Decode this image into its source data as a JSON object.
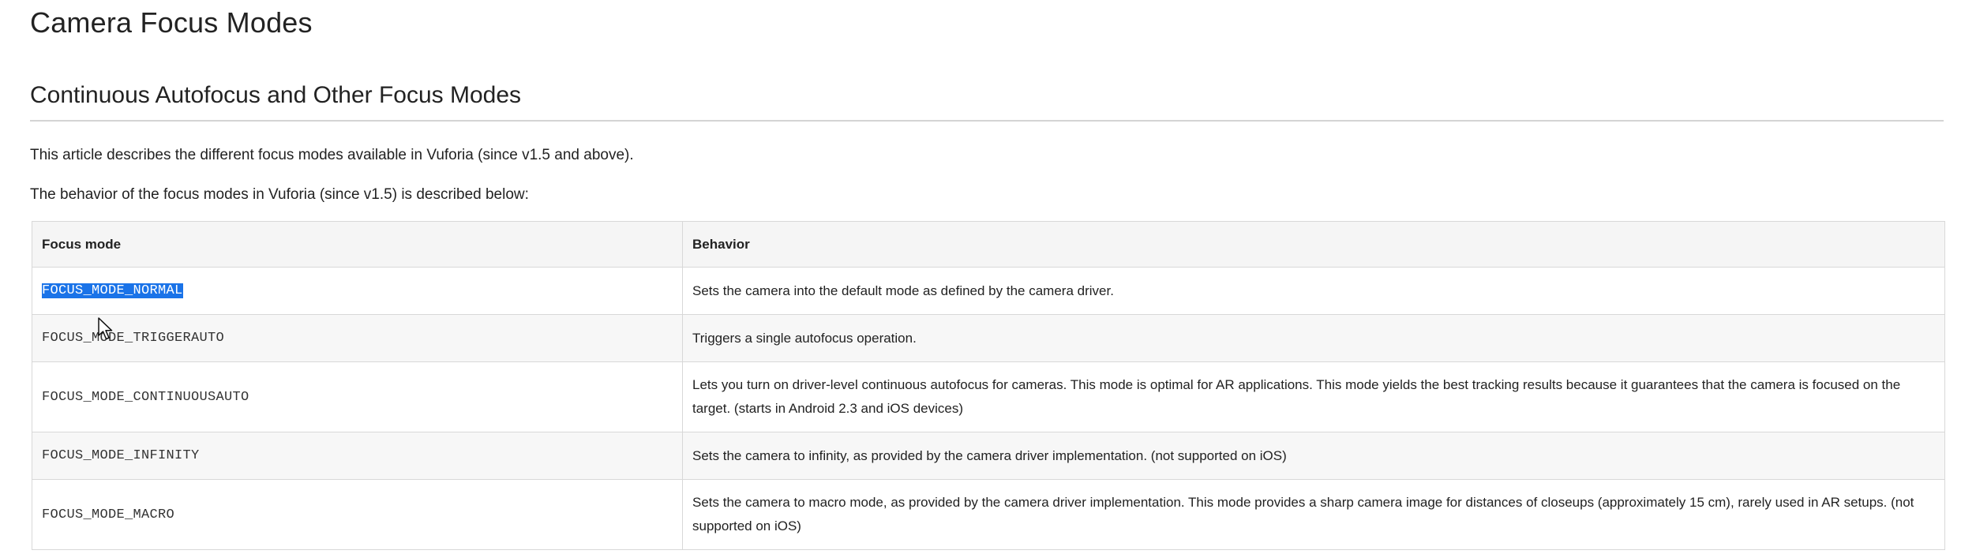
{
  "page": {
    "title": "Camera Focus Modes",
    "section_heading": "Continuous Autofocus and Other Focus Modes",
    "intro": "This article describes the different focus modes available in Vuforia (since v1.5 and above).",
    "lead_in": "The behavior of the focus modes in Vuforia (since v1.5) is described below:"
  },
  "table": {
    "headers": {
      "mode": "Focus mode",
      "behavior": "Behavior"
    },
    "rows": [
      {
        "mode": "FOCUS_MODE_NORMAL",
        "behavior": "Sets the camera into the default mode as defined by the camera driver."
      },
      {
        "mode": "FOCUS_MODE_TRIGGERAUTO",
        "behavior": "Triggers a single autofocus operation."
      },
      {
        "mode": "FOCUS_MODE_CONTINUOUSAUTO",
        "behavior": "Lets you turn on driver-level continuous autofocus for cameras. This mode is optimal for AR applications. This mode yields the best tracking results because it guarantees that the camera is focused on the target. (starts in Android 2.3 and iOS devices)"
      },
      {
        "mode": "FOCUS_MODE_INFINITY",
        "behavior": "Sets the camera to infinity, as provided by the camera driver implementation. (not supported on iOS)"
      },
      {
        "mode": "FOCUS_MODE_MACRO",
        "behavior": "Sets the camera to macro mode, as provided by the camera driver implementation. This mode provides a sharp camera image for distances of closeups (approximately 15 cm), rarely used in AR setups. (not supported on iOS)"
      }
    ]
  },
  "selection": {
    "highlight_color": "#1a73e8"
  },
  "icons": {
    "pointer": "mouse-pointer-icon"
  }
}
